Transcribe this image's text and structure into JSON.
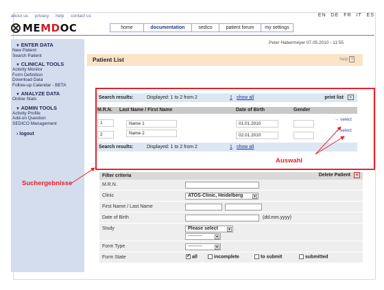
{
  "top_links": [
    "about us",
    "privacy",
    "help",
    "contact us"
  ],
  "languages": [
    "EN",
    "DE",
    "FR",
    "IT",
    "ES"
  ],
  "logo": {
    "text_pre": "ME",
    "text_mid": "MD",
    "text_post": "OC"
  },
  "nav": [
    {
      "label": "home",
      "active": false
    },
    {
      "label": "documentation",
      "active": true
    },
    {
      "label": "sedico",
      "active": false
    },
    {
      "label": "patient forum",
      "active": false
    },
    {
      "label": "my settings",
      "active": false
    }
  ],
  "user_line": "Peter Habermeyer   07.05.2010 - 11:55",
  "sidebar": {
    "sections": [
      {
        "title": "ENTER DATA",
        "items": [
          "New Patient",
          "Search Patient"
        ]
      },
      {
        "title": "CLINICAL TOOLS",
        "items": [
          "Activity Monitor",
          "Form Definition",
          "Download Data",
          "Follow-up Calendar - BETA"
        ]
      },
      {
        "title": "ANALYZE DATA",
        "items": [
          "Online Stats"
        ]
      },
      {
        "title": "ADMIN TOOLS",
        "items": [
          "Activity Profile",
          "Add-on Question",
          "SEDICO Management"
        ]
      }
    ],
    "logout": "logout"
  },
  "page_title": "Patient List",
  "help_label": "help",
  "results": {
    "label": "Search results:",
    "displayed": "Displayed: 1 to 2 from 2",
    "page": "1",
    "show_all": "show all",
    "print_list": "print list",
    "columns": [
      "M.R.N.",
      "Last Name / First Name",
      "Date of Birth",
      "Gender"
    ],
    "rows": [
      {
        "mrn": "1",
        "name": "Name 1",
        "dob": "01.01.2010",
        "gender": "",
        "action": "→ select"
      },
      {
        "mrn": "2",
        "name": "Name 2",
        "dob": "02.01.2010",
        "gender": "",
        "action": "→ select"
      }
    ]
  },
  "annotations": {
    "search_results": "Suchergebnisse",
    "selection": "Auswahl",
    "color": "#e8202a"
  },
  "filter": {
    "title": "Filter criteria",
    "delete_patient": "Delete Patient",
    "fields": {
      "mrn": "M.R.N.",
      "clinic": "Clinic",
      "clinic_value": "ATOS-Clinic, Heidelberg",
      "name": "First Name / Last Name",
      "dob": "Date of Birth",
      "dob_hint": "(dd.mm.yyyy)",
      "study": "Study",
      "study_value": "Please select",
      "study_sub_value": "---------",
      "form_type": "Form Type",
      "form_type_value": "---------",
      "form_state": "Form State",
      "form_state_options": [
        {
          "label": "all",
          "checked": true
        },
        {
          "label": "incomplete",
          "checked": false
        },
        {
          "label": "to submit",
          "checked": false
        },
        {
          "label": "submitted",
          "checked": false
        }
      ]
    }
  }
}
